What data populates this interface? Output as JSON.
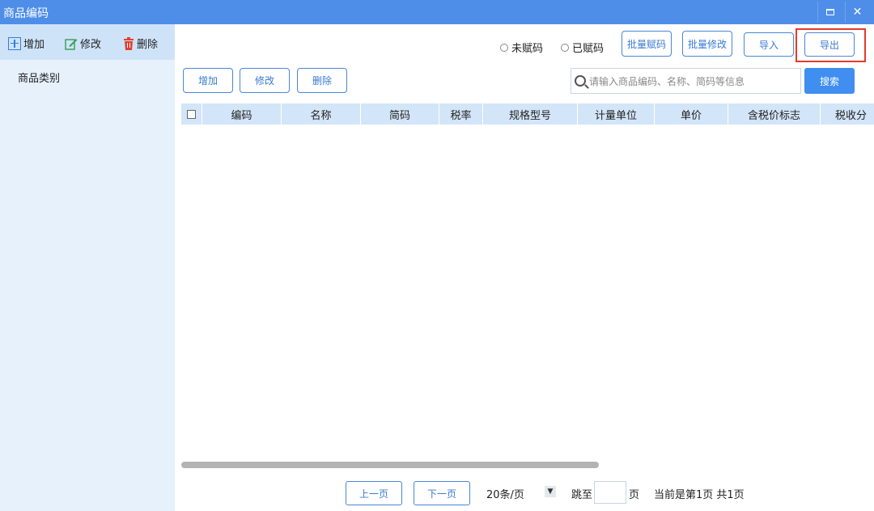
{
  "window": {
    "title": "商品编码"
  },
  "sidebar": {
    "toolbar": {
      "add_label": "增加",
      "edit_label": "修改",
      "delete_label": "删除"
    },
    "category_label": "商品类别"
  },
  "filters": {
    "unassigned_label": "未赋码",
    "assigned_label": "已赋码"
  },
  "top_buttons": {
    "batch_assign": "批量赋码",
    "batch_edit": "批量修改",
    "import": "导入",
    "export": "导出"
  },
  "actions": {
    "add": "增加",
    "edit": "修改",
    "delete": "删除"
  },
  "search": {
    "placeholder": "请输入商品编码、名称、简码等信息",
    "button": "搜索"
  },
  "table": {
    "columns": [
      "编码",
      "名称",
      "简码",
      "税率",
      "规格型号",
      "计量单位",
      "单价",
      "含税价标志",
      "税收分"
    ],
    "rows": []
  },
  "pagination": {
    "prev": "上一页",
    "next": "下一页",
    "page_size": "20条/页",
    "jump_label": "跳至",
    "page_unit": "页",
    "status": "当前是第1页 共1页"
  },
  "colors": {
    "title_bar": "#4f8ee8",
    "sidebar_bg": "#e6f1fc",
    "header_bg": "#d3e5f8",
    "accent": "#3f8ef0",
    "highlight": "#e53a2b"
  }
}
